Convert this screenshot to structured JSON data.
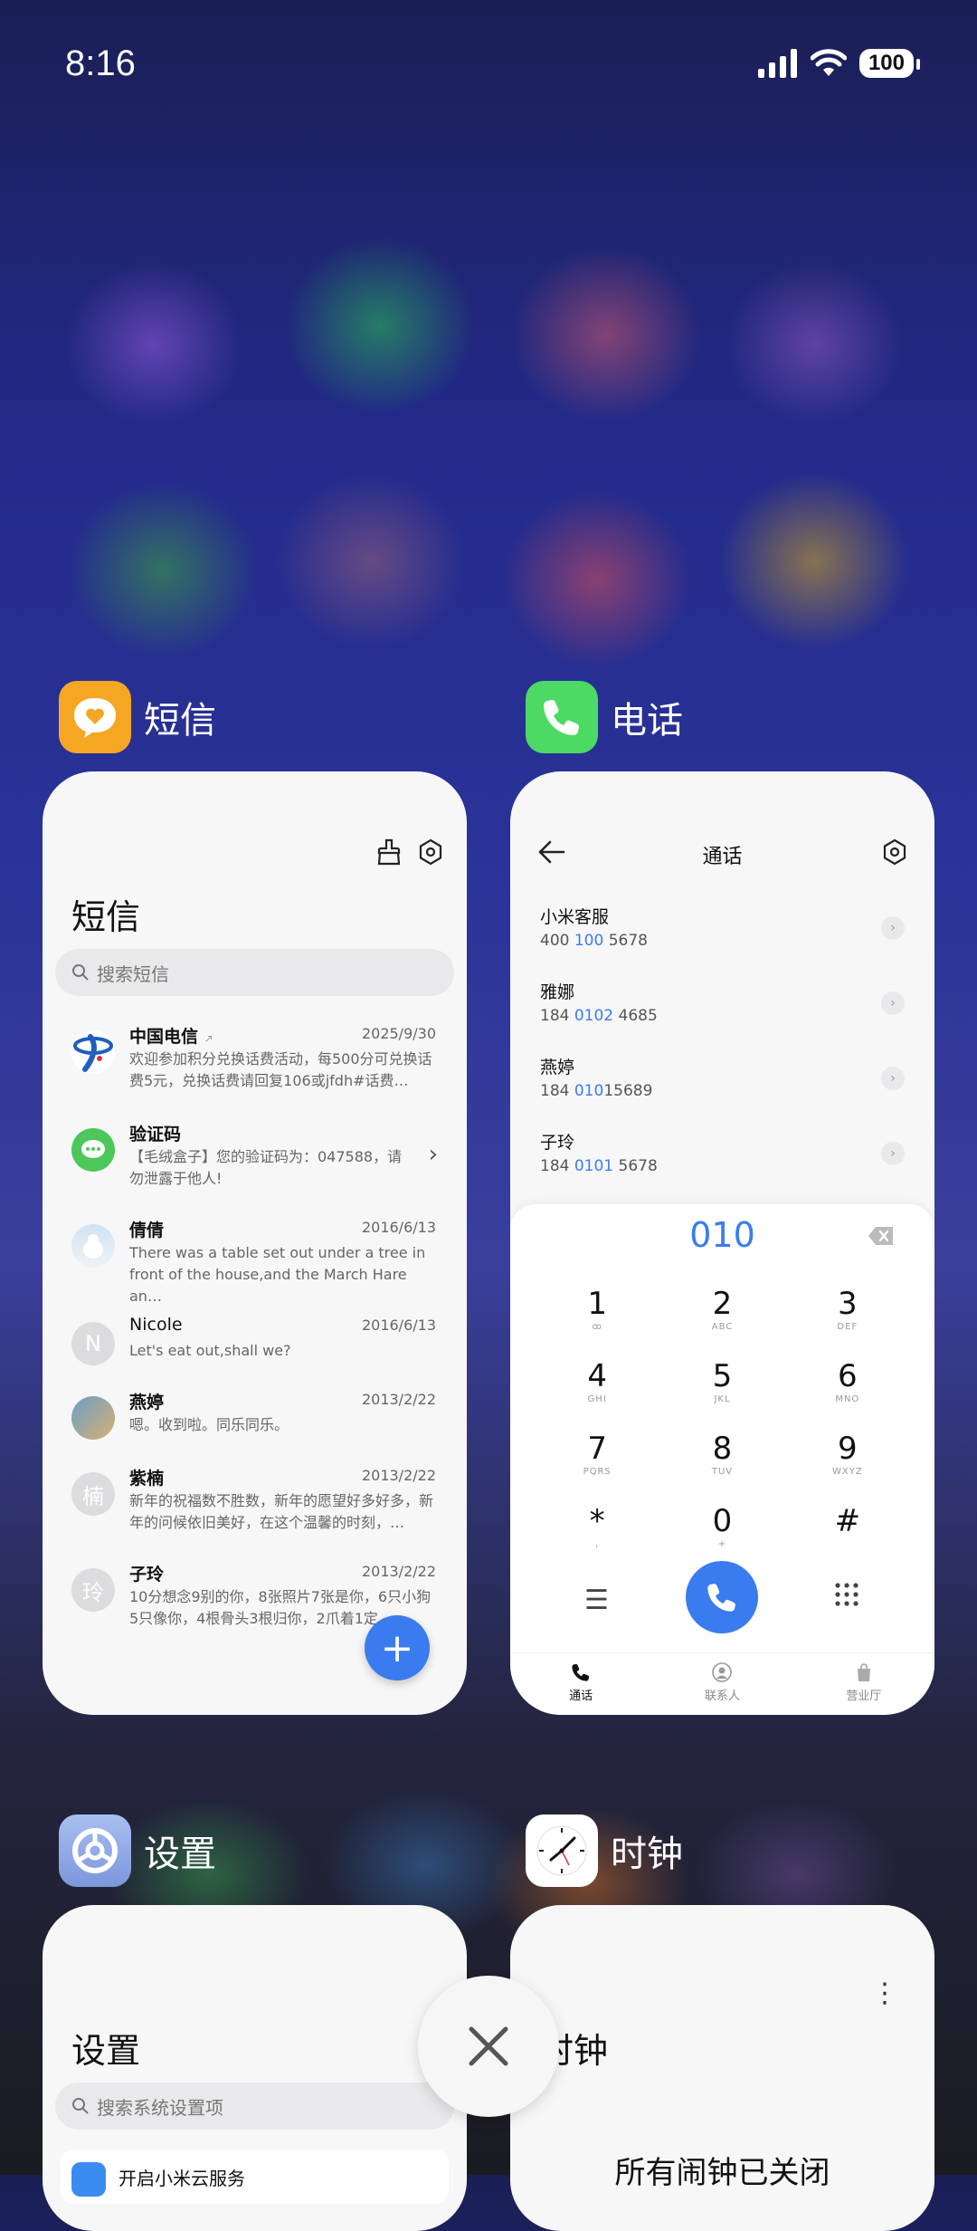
{
  "status_bar": {
    "time": "8:16",
    "battery": "100"
  },
  "sms_app": {
    "name": "短信",
    "heading": "短信",
    "search_placeholder": "搜索短信",
    "messages": [
      {
        "name": "中国电信",
        "date": "2025/9/30",
        "preview": "欢迎参加积分兑换话费活动，每500分可兑换话费5元，兑换话费请回复106或jfdh#话费…"
      },
      {
        "name": "验证码",
        "date": "",
        "preview": "【毛绒盒子】您的验证码为：047588，请勿泄露于他人!"
      },
      {
        "name": "倩倩",
        "date": "2016/6/13",
        "preview": "There was a table set out under a tree in front of the house,and the March Hare an…"
      },
      {
        "name": "Nicole",
        "date": "2016/6/13",
        "preview": "Let's eat out,shall we?"
      },
      {
        "name": "燕婷",
        "date": "2013/2/22",
        "preview": "嗯。收到啦。同乐同乐。"
      },
      {
        "name": "紫楠",
        "date": "2013/2/22",
        "preview": "新年的祝福数不胜数，新年的愿望好多好多，新年的问候依旧美好，在这个温馨的时刻，…"
      },
      {
        "name": "子玲",
        "date": "2013/2/22",
        "preview": "10分想念9别的你，8张照片7张是你，6只小狗5只像你，4根骨头3根归你，2爪着1定…"
      }
    ],
    "avatar_letters": {
      "nicole": "N",
      "zinan": "楠",
      "ziling": "玲"
    }
  },
  "phone_app": {
    "name": "电话",
    "title": "通话",
    "contacts": [
      {
        "name": "小米客服",
        "num_pre": "400 ",
        "num_hl": "100",
        "num_post": " 5678"
      },
      {
        "name": "雅娜",
        "num_pre": "184 ",
        "num_hl": "0102",
        "num_post": " 4685"
      },
      {
        "name": "燕婷",
        "num_pre": "184 ",
        "num_hl": "010",
        "num_post": "15689"
      },
      {
        "name": "子玲",
        "num_pre": "184 ",
        "num_hl": "0101",
        "num_post": " 5678"
      }
    ],
    "dial_input": "010",
    "keys": [
      {
        "d": "1",
        "l": "ꝏ"
      },
      {
        "d": "2",
        "l": "ABC"
      },
      {
        "d": "3",
        "l": "DEF"
      },
      {
        "d": "4",
        "l": "GHI"
      },
      {
        "d": "5",
        "l": "JKL"
      },
      {
        "d": "6",
        "l": "MNO"
      },
      {
        "d": "7",
        "l": "PQRS"
      },
      {
        "d": "8",
        "l": "TUV"
      },
      {
        "d": "9",
        "l": "WXYZ"
      },
      {
        "d": "*",
        "l": ","
      },
      {
        "d": "0",
        "l": "+"
      },
      {
        "d": "#",
        "l": ""
      }
    ],
    "nav": [
      "通话",
      "联系人",
      "营业厅"
    ]
  },
  "settings_app": {
    "name": "设置",
    "heading": "设置",
    "search_placeholder": "搜索系统设置项",
    "first_item": "开启小米云服务"
  },
  "clock_app": {
    "name": "时钟",
    "heading": "时钟",
    "message": "所有闹钟已关闭"
  },
  "colors": {
    "accent": "#3a7bf0",
    "sms_icon": "#f5a623",
    "phone_icon": "#4cd964",
    "settings_icon": "#8fa8e8"
  }
}
